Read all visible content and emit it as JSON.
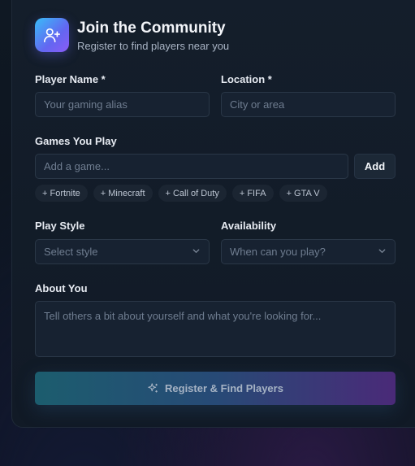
{
  "header": {
    "title": "Join the Community",
    "subtitle": "Register to find players near you",
    "icon": "user-plus-icon"
  },
  "form": {
    "player_name": {
      "label": "Player Name *",
      "placeholder": "Your gaming alias"
    },
    "location": {
      "label": "Location *",
      "placeholder": "City or area"
    },
    "games": {
      "label": "Games You Play",
      "placeholder": "Add a game...",
      "add_label": "Add",
      "suggestions": [
        "+ Fortnite",
        "+ Minecraft",
        "+ Call of Duty",
        "+ FIFA",
        "+ GTA V"
      ]
    },
    "play_style": {
      "label": "Play Style",
      "placeholder": "Select style"
    },
    "availability": {
      "label": "Availability",
      "placeholder": "When can you play?"
    },
    "about": {
      "label": "About You",
      "placeholder": "Tell others a bit about yourself and what you're looking for..."
    },
    "submit_label": "Register & Find Players"
  },
  "colors": {
    "accent_start": "#38bdf8",
    "accent_end": "#8b5cf6",
    "card_bg": "#141e2b",
    "field_bg": "#172231"
  }
}
